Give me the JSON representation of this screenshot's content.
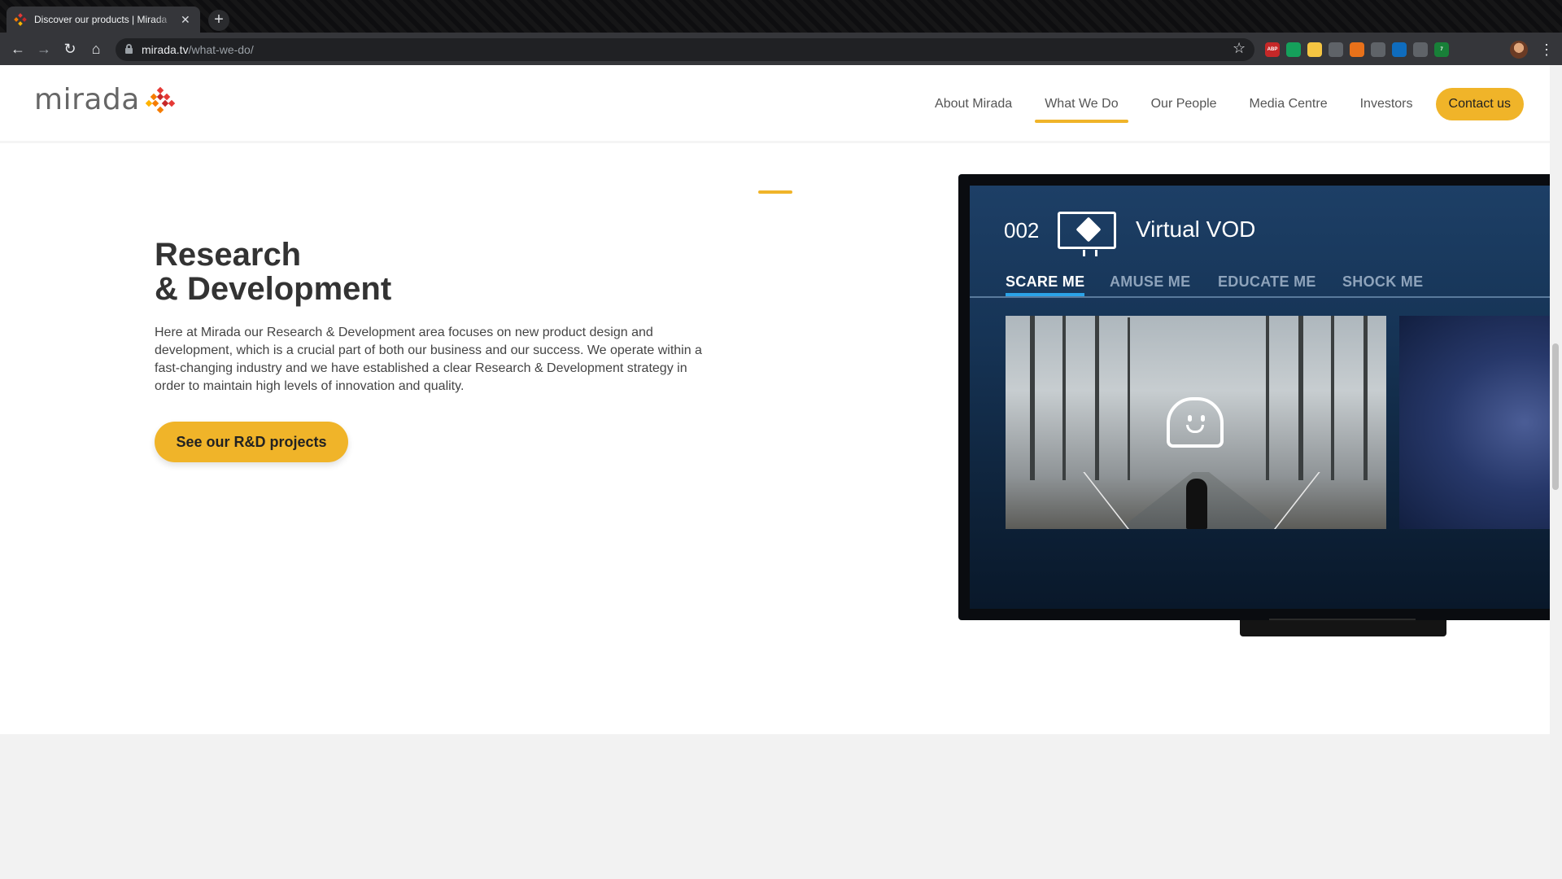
{
  "browser": {
    "tab_title": "Discover our products | Mirada",
    "tab_close": "✕",
    "new_tab": "+",
    "url_domain": "mirada.tv",
    "url_path": "/what-we-do/",
    "extensions": [
      {
        "name": "adblock-icon",
        "color": "#c62828",
        "label": "ABP"
      },
      {
        "name": "grammarly-icon",
        "color": "#15a05b",
        "label": ""
      },
      {
        "name": "notes-icon",
        "color": "#f5c542",
        "label": ""
      },
      {
        "name": "target-icon",
        "color": "#5f6368",
        "label": ""
      },
      {
        "name": "fox-icon",
        "color": "#e8711a",
        "label": ""
      },
      {
        "name": "chat-icon",
        "color": "#5f6368",
        "label": ""
      },
      {
        "name": "outlook-icon",
        "color": "#0f6cbd",
        "label": ""
      },
      {
        "name": "dots-icon",
        "color": "#5f6368",
        "label": ""
      },
      {
        "name": "badge-icon",
        "color": "#188038",
        "label": "7"
      }
    ]
  },
  "header": {
    "logo_text": "mirada",
    "nav": [
      {
        "label": "About Mirada",
        "active": false
      },
      {
        "label": "What We Do",
        "active": true
      },
      {
        "label": "Our People",
        "active": false
      },
      {
        "label": "Media Centre",
        "active": false
      },
      {
        "label": "Investors",
        "active": false
      }
    ],
    "contact": "Contact us"
  },
  "section": {
    "title_line1": "Research",
    "title_line2": "& Development",
    "body": "Here at Mirada our Research & Development area focuses on new product design and development, which is a crucial part of both our business and our success. We operate within a fast-changing industry and we have established a clear Research & Development strategy in order to maintain high levels of innovation and quality.",
    "button": "See our R&D projects"
  },
  "tv": {
    "channel": "002",
    "title": "Virtual VOD",
    "tabs": [
      "SCARE ME",
      "AMUSE ME",
      "EDUCATE ME",
      "SHOCK ME"
    ],
    "active_tab": 0
  },
  "colors": {
    "accent": "#f0b429",
    "tab_highlight": "#2ba3e8"
  }
}
